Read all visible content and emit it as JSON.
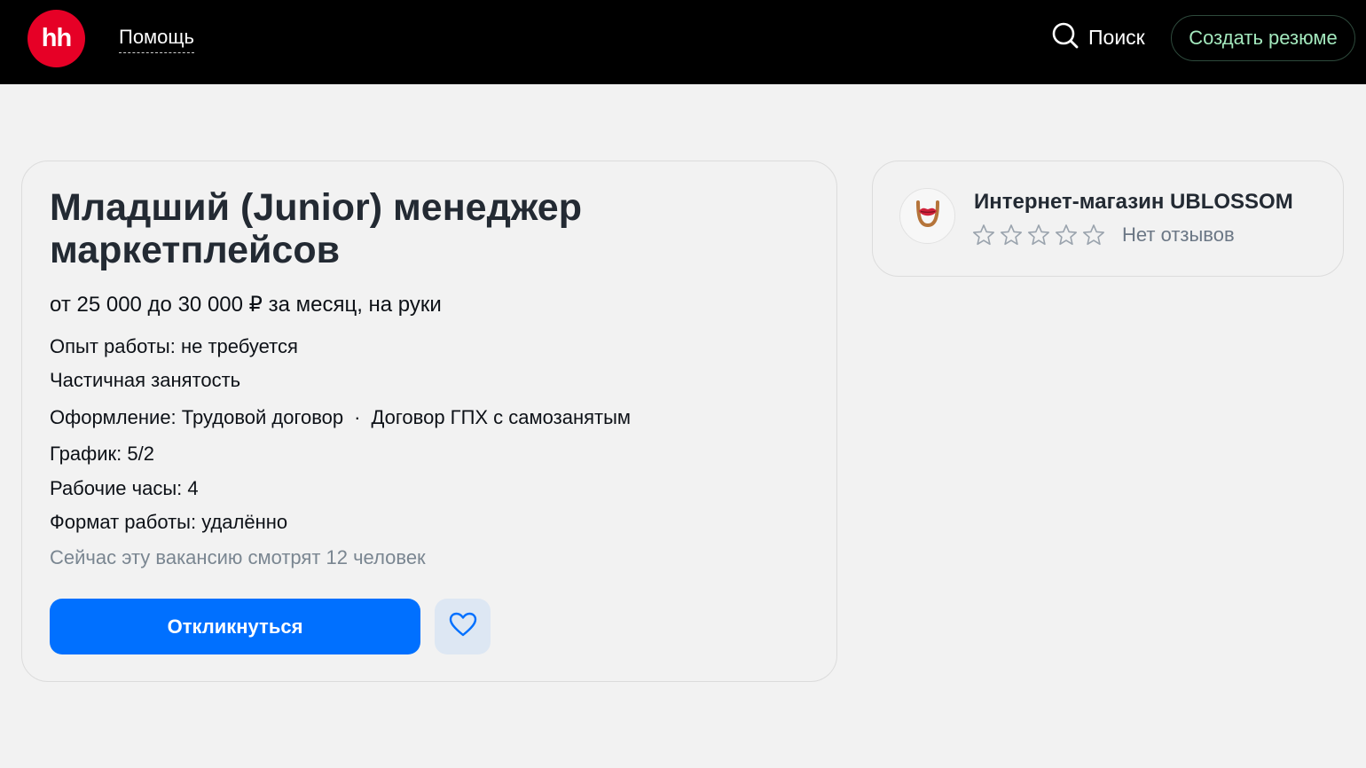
{
  "header": {
    "logo_text": "hh",
    "help_label": "Помощь",
    "search_label": "Поиск",
    "create_resume_label": "Создать резюме",
    "brand_color": "#e60026",
    "accent_green": "#a3e8bd"
  },
  "vacancy": {
    "title": "Младший (Junior) менеджер маркетплейсов",
    "salary": "от 25 000 до 30 000 ₽ за месяц, на руки",
    "experience": "Опыт работы: не требуется",
    "employment": "Частичная занятость",
    "contract_prefix": "Оформление: Трудовой договор",
    "contract_dot": "·",
    "contract_extra": "Договор ГПХ с самозанятым",
    "schedule": "График: 5/2",
    "hours": "Рабочие часы: 4",
    "format": "Формат работы: удалённо",
    "viewers": "Сейчас эту вакансию смотрят 12 человек",
    "apply_label": "Откликнуться",
    "apply_color": "#0070ff",
    "favorite_icon": "heart-icon"
  },
  "employer": {
    "name": "Интернет-магазин UBLOSSOM",
    "rating_stars": 0,
    "rating_max": 5,
    "reviews_text": "Нет отзывов",
    "logo_icon": "lips-logo-icon"
  }
}
